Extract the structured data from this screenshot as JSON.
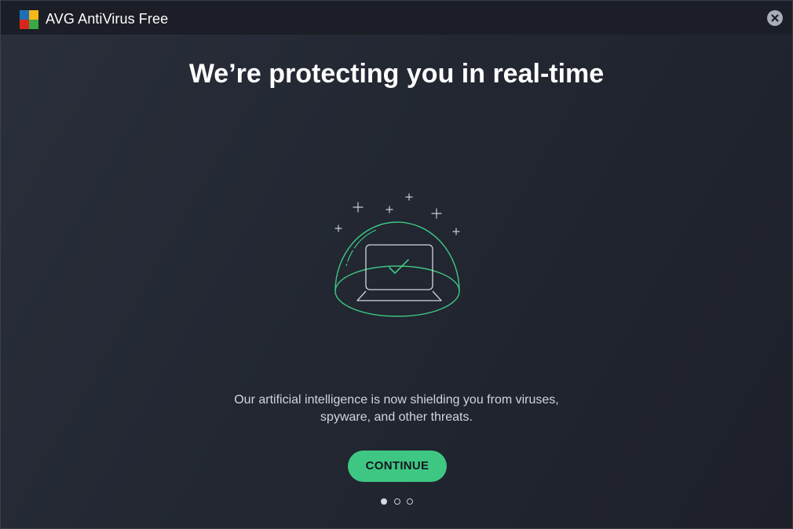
{
  "window": {
    "title": "AVG AntiVirus Free",
    "close_icon": "close-icon"
  },
  "onboarding": {
    "headline": "We’re protecting you in real-time",
    "description_lines": [
      "Our artificial intelligence is now shielding you from viruses,",
      "spyware, and other threats."
    ],
    "continue_label": "CONTINUE",
    "pagination": {
      "total": 3,
      "current": 1
    }
  },
  "illustration": {
    "icon": "shielded-laptop-icon"
  },
  "colors": {
    "accent_green": "#3ec783",
    "background": "#1f232d",
    "titlebar": "#1b1e26",
    "text_primary": "#ffffff",
    "text_secondary": "#d2d5db"
  }
}
